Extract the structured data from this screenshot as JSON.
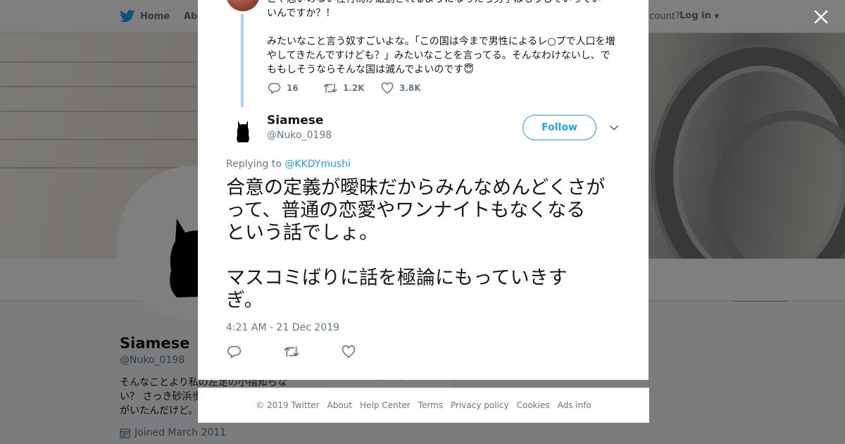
{
  "nav": {
    "home_label": "Home",
    "about_label": "Abo",
    "account_prompt": "ccount?",
    "login_label": "Log in"
  },
  "profile": {
    "name": "Siamese",
    "handle": "@Nuko_0198",
    "bio": "そんなことより私の左足の小指知らない？ さっき砂浜歩いてたら何か黒いのがいたんだけど。",
    "joined": "Joined March 2011",
    "ads_partial": "Ads info"
  },
  "previous_tweet": {
    "lines_top": [
      "ことや思いのない性行為が厳罰されるようになったら男子はもうしていっていいんですか？！",
      "いんですか？！"
    ],
    "line_1": "いんですか？！",
    "line_2": "みたいなこと言う奴すごいよな。「この国は今まで男性によるレ○プで人口を増",
    "line_3": "やしてきたんですけども？」みたいなことを言ってる。そんなわけないし、で",
    "line_4": "ももしそうならそんな国は滅んでよいのです",
    "emoji": "😇",
    "replies": "16",
    "retweets": "1.2K",
    "likes": "3.8K"
  },
  "tweet": {
    "author_name": "Siamese",
    "author_handle": "@Nuko_0198",
    "follow_label": "Follow",
    "replying_prefix": "Replying to",
    "replying_handle": "@KKDYmushi",
    "text_line_1": "合意の定義が曖昧だからみんなめんどくさが",
    "text_line_2": "って、普通の恋愛やワンナイトもなくなる",
    "text_line_3": "という話でしょ。",
    "text_line_4": "マスコミばりに話を極論にもっていきす",
    "text_line_5": "ぎ。",
    "timestamp": "4:21 AM - 21 Dec 2019"
  },
  "footer": {
    "copyright": "© 2019 Twitter",
    "about": "About",
    "help": "Help Center",
    "terms": "Terms",
    "privacy": "Privacy policy",
    "cookies": "Cookies",
    "ads": "Ads info"
  },
  "colors": {
    "twitter_blue": "#1da1f2",
    "thread_line": "#a5d7f5",
    "text_primary": "#14171a",
    "text_secondary": "#657786"
  },
  "icons": {
    "logo": "twitter-bird-icon",
    "close": "close-icon",
    "reply": "reply-icon",
    "retweet": "retweet-icon",
    "like": "heart-icon",
    "caret": "chevron-down-icon",
    "calendar": "calendar-icon"
  }
}
